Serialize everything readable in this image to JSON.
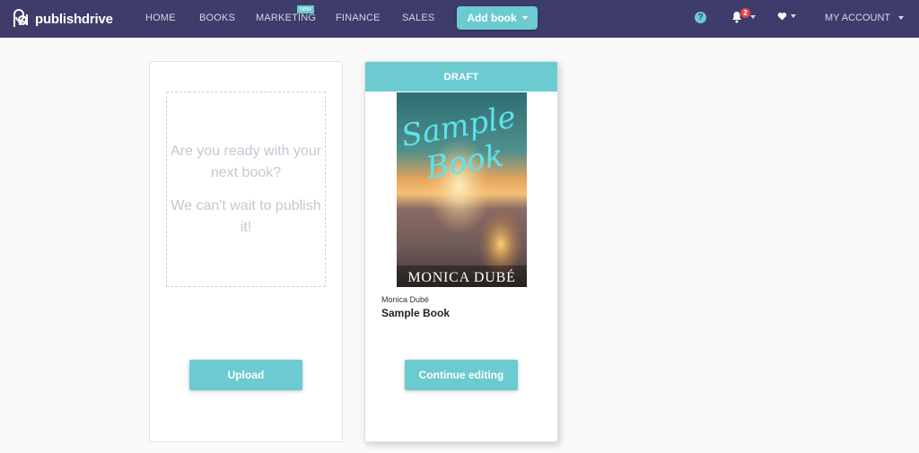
{
  "brand": {
    "name": "publishdrive"
  },
  "nav": {
    "home": "HOME",
    "books": "BOOKS",
    "marketing": "MARKETING",
    "marketing_badge": "new",
    "finance": "FINANCE",
    "sales": "SALES",
    "add_book": "Add book",
    "help": "?",
    "notification_count": "2",
    "account": "MY ACCOUNT"
  },
  "upload_card": {
    "prompt_line1": "Are you ready with your next book?",
    "prompt_line2": "We can't wait to publish it!",
    "upload_button": "Upload"
  },
  "draft_card": {
    "status": "DRAFT",
    "cover_title": "Sample Book",
    "cover_author": "MONICA DUBÉ",
    "author": "Monica Dubé",
    "title": "Sample Book",
    "continue_button": "Continue editing"
  },
  "colors": {
    "navbar": "#3e3c6a",
    "accent": "#6ccbd1",
    "badge_red": "#e2434b"
  },
  "icons": [
    "publishdrive-logo-icon",
    "help-icon",
    "bell-icon",
    "heart-icon",
    "chevron-down-icon"
  ]
}
